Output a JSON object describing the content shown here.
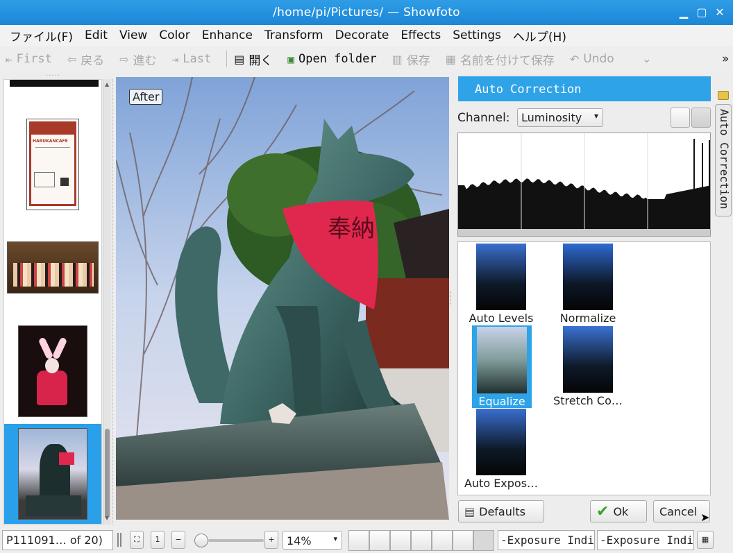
{
  "window": {
    "title": "/home/pi/Pictures/ — Showfoto"
  },
  "menu": [
    "ファイル(F)",
    "Edit",
    "View",
    "Color",
    "Enhance",
    "Transform",
    "Decorate",
    "Effects",
    "Settings",
    "ヘルプ(H)"
  ],
  "toolbar": {
    "first": "First",
    "back": "戻る",
    "forward": "進む",
    "last": "Last",
    "open": "開く",
    "open_folder": "Open folder",
    "save": "保存",
    "save_as": "名前を付けて保存",
    "undo": "Undo",
    "more": "»"
  },
  "canvas": {
    "label": "After",
    "banner_text": "奉納"
  },
  "panel": {
    "title": "Auto Correction",
    "channel_label": "Channel:",
    "channel_value": "Luminosity",
    "side_tab": "Auto Correction",
    "filters": [
      {
        "label": "Auto Levels",
        "selected": false
      },
      {
        "label": "Normalize",
        "selected": false
      },
      {
        "label": "Equalize",
        "selected": true
      },
      {
        "label": "Stretch Co…",
        "selected": false
      },
      {
        "label": "Auto Expos…",
        "selected": false
      }
    ],
    "defaults_label": "Defaults",
    "ok_label": "Ok",
    "cancel_label": "Cancel"
  },
  "thumbnails": {
    "poster_text": "HARUKANCAFE"
  },
  "status": {
    "file_info": "P111091… of 20)",
    "zoom_value": "14%",
    "exposure_1": "-Exposure Indi",
    "exposure_2": "-Exposure Indic"
  },
  "colors": {
    "accent": "#2ea3e8",
    "titlebar": "#1c86d6",
    "banner": "#e0284f"
  }
}
